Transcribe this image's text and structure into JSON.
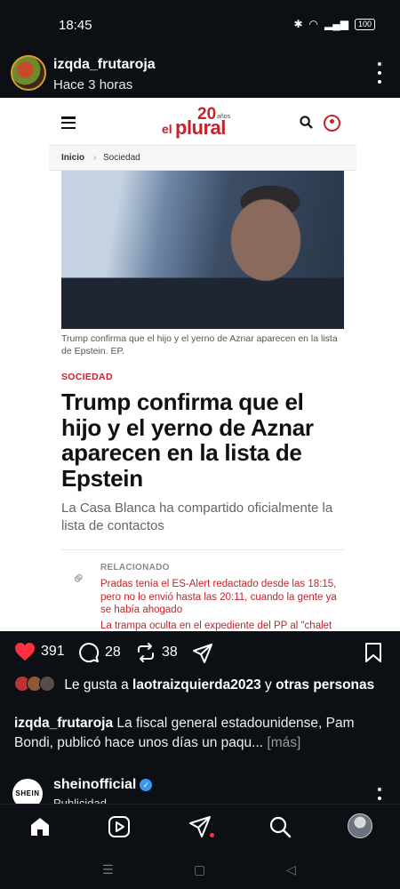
{
  "status_bar": {
    "time": "18:45",
    "battery": "100"
  },
  "post": {
    "username": "izqda_frutaroja",
    "time_ago": "Hace 3 horas"
  },
  "article": {
    "logo_prefix": "el",
    "logo_main": "plural",
    "logo_anniversary": "20",
    "logo_anos": "años",
    "breadcrumb": [
      "Inicio",
      "Sociedad"
    ],
    "breadcrumb_sep": "›",
    "photo_caption": "Trump confirma que el hijo y el yerno de Aznar aparecen en la lista de Epstein. EP.",
    "section": "SOCIEDAD",
    "headline": "Trump confirma que el hijo y el yerno de Aznar aparecen en la lista de Epstein",
    "subheadline": "La Casa Blanca ha compartido oficialmente la lista de contactos",
    "related_label": "RELACIONADO",
    "related_items": [
      "Pradas tenía el ES-Alert redactado desde las 18:15, pero no lo envió hasta las 20:11, cuando la gente ya se había ahogado",
      "La trampa oculta en el expediente del PP al \"chalet"
    ]
  },
  "actions": {
    "likes": "391",
    "comments": "28",
    "reposts": "38"
  },
  "likes_line": {
    "prefix": "Le gusta a ",
    "user": "laotraizquierda2023",
    "connector": " y ",
    "others": "otras personas"
  },
  "caption": {
    "user": "izqda_frutaroja",
    "text": " La fiscal general estadounidense, Pam Bondi, publicó hace unos días un paqu...",
    "more": " [más]"
  },
  "next_post": {
    "username": "sheinofficial",
    "avatar_text": "SHEIN",
    "subtitle": "Publicidad"
  },
  "colors": {
    "background": "#0c0f14",
    "brand_red": "#c3232b",
    "like_red": "#ff3040",
    "verified_blue": "#3897f0"
  },
  "icons": {
    "like": "heart-filled-icon",
    "comment": "comment-bubble-icon",
    "repost": "repost-arrows-icon",
    "share": "paper-plane-icon",
    "save": "bookmark-icon",
    "nav": [
      "home-icon",
      "reels-icon",
      "send-icon",
      "search-icon",
      "profile-avatar"
    ]
  }
}
